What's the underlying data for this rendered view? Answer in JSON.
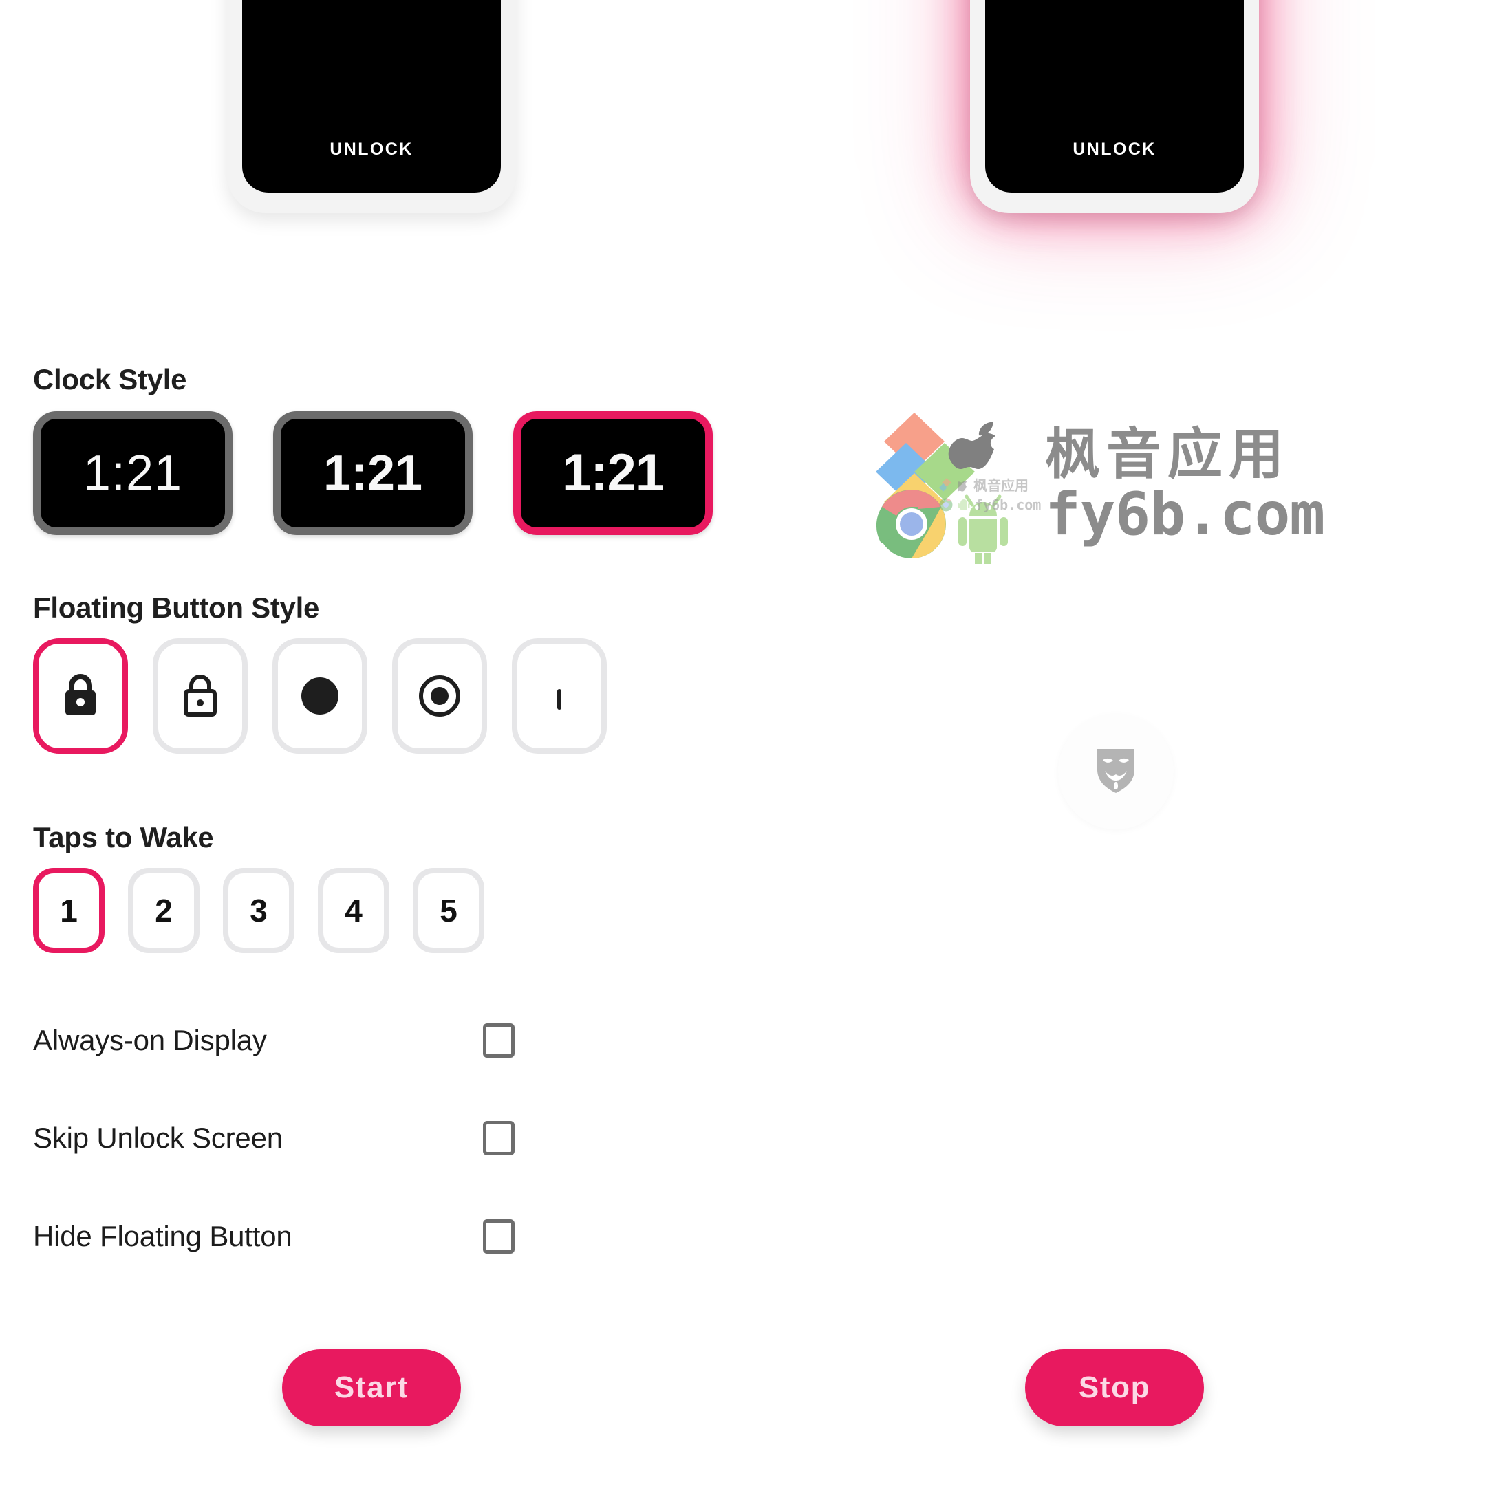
{
  "app": {
    "accent_color": "#E8195F",
    "unselected_border_color": "#E6E6E8",
    "clock_border_color": "#6B6B6B",
    "button_text_color": "#FBD9E5",
    "background_color": "#FFFFFF"
  },
  "preview": {
    "unlock_label": "UNLOCK",
    "left_state": "inactive",
    "right_state": "active-glowing"
  },
  "sections": {
    "clock_style": {
      "title": "Clock Style",
      "options": [
        {
          "time": "1:21",
          "weight": "light",
          "selected": false
        },
        {
          "time": "1:21",
          "weight": "medium",
          "selected": false
        },
        {
          "time": "1:21",
          "weight": "bold",
          "selected": true
        }
      ]
    },
    "floating_button_style": {
      "title": "Floating Button Style",
      "options": [
        {
          "icon": "lock-filled-icon",
          "selected": true
        },
        {
          "icon": "lock-outline-icon",
          "selected": false
        },
        {
          "icon": "circle-filled-icon",
          "selected": false
        },
        {
          "icon": "circle-ring-icon",
          "selected": false
        },
        {
          "icon": "partial-icon",
          "selected": false
        }
      ]
    },
    "taps_to_wake": {
      "title": "Taps to Wake",
      "options": [
        "1",
        "2",
        "3",
        "4",
        "5"
      ],
      "selected": "1"
    },
    "toggles": [
      {
        "label": "Always-on Display",
        "checked": false
      },
      {
        "label": "Skip Unlock Screen",
        "checked": false
      },
      {
        "label": "Hide Floating Button",
        "checked": false
      }
    ]
  },
  "actions": {
    "left_button": "Start",
    "right_button": "Stop"
  },
  "watermark": {
    "chinese": "枫音应用",
    "domain": "fy6b.com",
    "inner_chinese": "枫音应用",
    "inner_domain": "fy6b.com",
    "icons": [
      "windows-icon",
      "apple-icon",
      "chrome-icon",
      "android-icon"
    ]
  },
  "badge": {
    "icon": "anonymous-mask-icon"
  }
}
